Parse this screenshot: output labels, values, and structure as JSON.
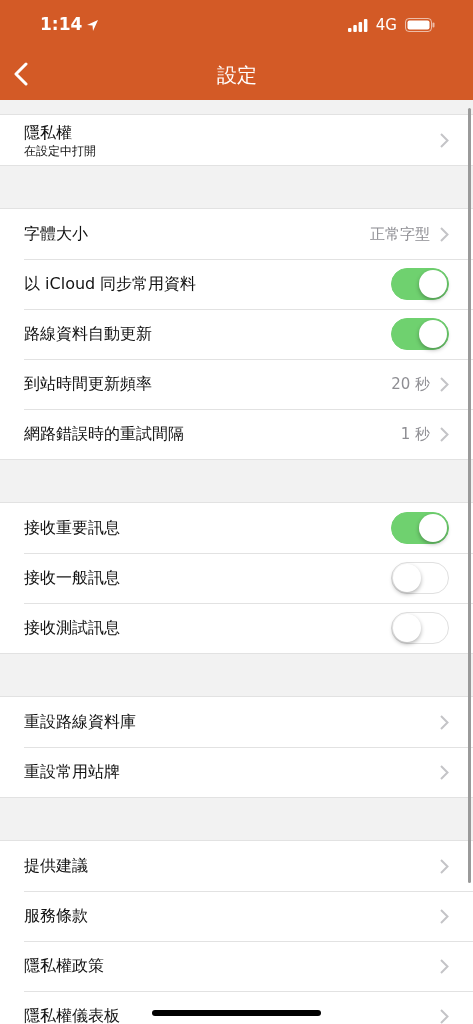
{
  "status_bar": {
    "time": "1:14",
    "network": "4G"
  },
  "nav_bar": {
    "title": "設定"
  },
  "groups": [
    {
      "items": [
        {
          "kind": "nav",
          "label": "隱私權",
          "subtitle": "在設定中打開"
        }
      ]
    },
    {
      "items": [
        {
          "kind": "nav",
          "label": "字體大小",
          "value": "正常字型"
        },
        {
          "kind": "toggle",
          "label": "以 iCloud 同步常用資料",
          "on": true
        },
        {
          "kind": "toggle",
          "label": "路線資料自動更新",
          "on": true
        },
        {
          "kind": "nav",
          "label": "到站時間更新頻率",
          "value": "20 秒"
        },
        {
          "kind": "nav",
          "label": "網路錯誤時的重試間隔",
          "value": "1 秒"
        }
      ]
    },
    {
      "items": [
        {
          "kind": "toggle",
          "label": "接收重要訊息",
          "on": true
        },
        {
          "kind": "toggle",
          "label": "接收一般訊息",
          "on": false
        },
        {
          "kind": "toggle",
          "label": "接收測試訊息",
          "on": false
        }
      ]
    },
    {
      "items": [
        {
          "kind": "nav",
          "label": "重設路線資料庫"
        },
        {
          "kind": "nav",
          "label": "重設常用站牌"
        }
      ]
    },
    {
      "items": [
        {
          "kind": "nav",
          "label": "提供建議"
        },
        {
          "kind": "nav",
          "label": "服務條款"
        },
        {
          "kind": "nav",
          "label": "隱私權政策"
        },
        {
          "kind": "nav",
          "label": "隱私權儀表板"
        }
      ]
    }
  ]
}
